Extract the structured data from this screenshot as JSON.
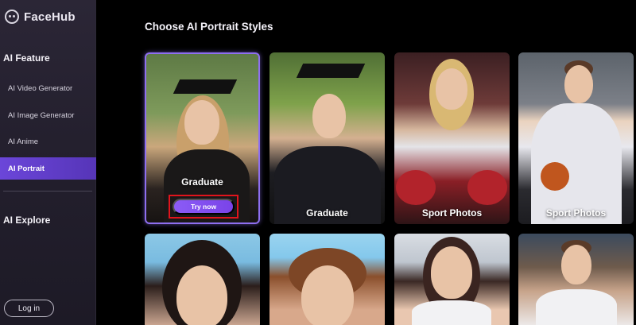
{
  "sidebar": {
    "brand": "FaceHub",
    "sections": [
      {
        "title": "AI Feature"
      },
      {
        "title": "AI Explore"
      }
    ],
    "items": [
      {
        "label": "AI Video Generator",
        "active": false
      },
      {
        "label": "AI Image Generator",
        "active": false
      },
      {
        "label": "AI Anime",
        "active": false
      },
      {
        "label": "AI Portrait",
        "active": true
      }
    ],
    "login_label": "Log in"
  },
  "main": {
    "title": "Choose AI Portrait Styles",
    "cards": [
      {
        "label": "Graduate",
        "selected": true
      },
      {
        "label": "Graduate",
        "selected": false
      },
      {
        "label": "Sport Photos",
        "selected": false
      },
      {
        "label": "Sport Photos",
        "selected": false
      },
      {
        "label": "",
        "selected": false
      },
      {
        "label": "",
        "selected": false
      },
      {
        "label": "",
        "selected": false
      },
      {
        "label": "",
        "selected": false
      }
    ],
    "try_now_label": "Try now"
  },
  "colors": {
    "accent": "#6b46d9",
    "highlight": "#e0141c",
    "background": "#000000"
  }
}
